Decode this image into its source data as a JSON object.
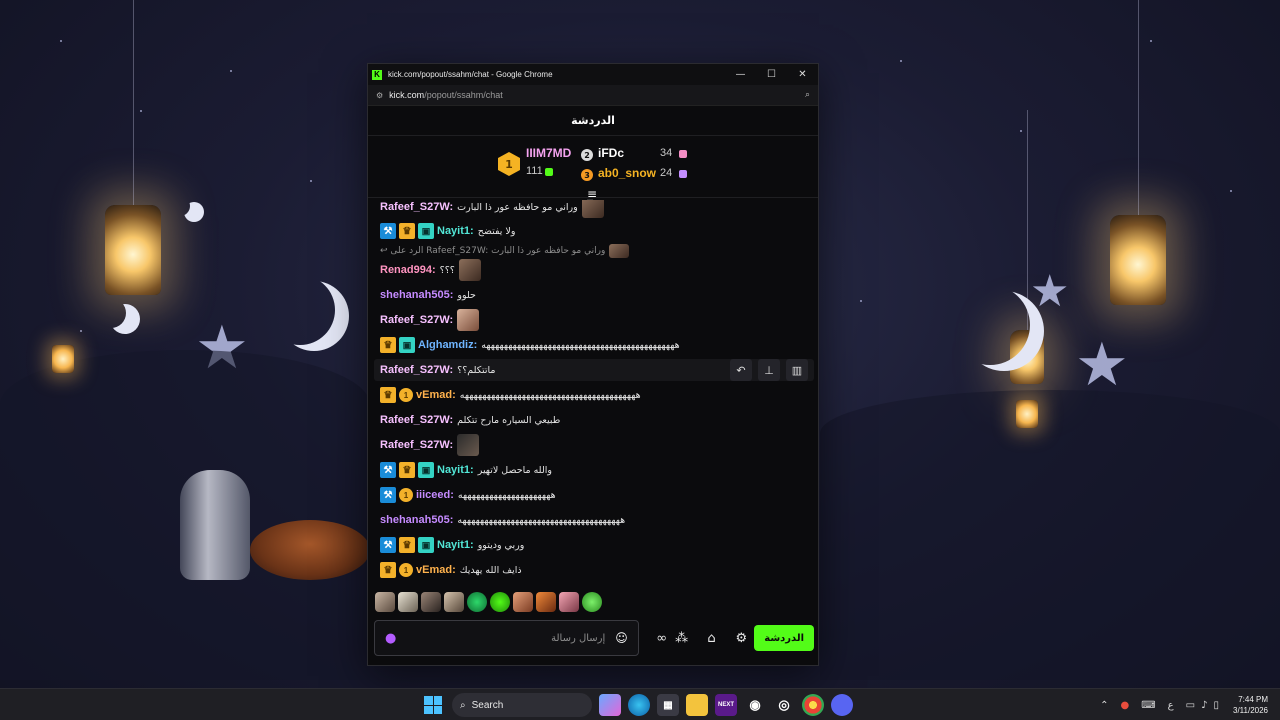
{
  "window": {
    "title": "kick.com/popout/ssahm/chat - Google Chrome",
    "logo_letter": "K",
    "minimize": "—",
    "maximize": "☐",
    "close": "✕"
  },
  "address_bar": {
    "domain": "kick.com",
    "path": "/popout/ssahm/chat"
  },
  "chat": {
    "header_title": "الدردشة",
    "leaderboard": {
      "first": {
        "rank": "1",
        "name": "IIIM7MD",
        "count": "111",
        "color": "#f5a3f0"
      },
      "second": {
        "rank": "2",
        "name": "iFDc",
        "count": "34",
        "color": "#ffffff"
      },
      "third": {
        "rank": "3",
        "name": "ab0_snow",
        "count": "24",
        "color": "#f5b323"
      }
    },
    "messages": [
      {
        "user": "Rafeef_S27W",
        "color": "#f7c1ff",
        "text": "وراني مو حافظه عور ذا البارت"
      },
      {
        "user": "Nayit1",
        "color": "#52e6d6",
        "text": "ولا يفتضح"
      },
      {
        "reply_to": "الرد على Rafeef_S27W: وراني مو حافظه عور ذا البارت"
      },
      {
        "user": "Renad994",
        "color": "#ff94c0",
        "text": "؟؟؟"
      },
      {
        "user": "shehanah505",
        "color": "#c58bff",
        "text": "حلوو"
      },
      {
        "user": "Rafeef_S27W",
        "color": "#f7c1ff",
        "text": ""
      },
      {
        "user": "Alghamdiz",
        "color": "#6fb5ff",
        "text": "ههههههههههههههههههههههههههههههههههههههههههههه"
      },
      {
        "user": "Rafeef_S27W",
        "color": "#f7c1ff",
        "text": "ماتتكلم؟؟"
      },
      {
        "user": "vEmad",
        "color": "#ffb24d",
        "text": "ههههههههههههههههههههههههههههههههههههههههه"
      },
      {
        "user": "Rafeef_S27W",
        "color": "#f7c1ff",
        "text": "طبيعي السياره مارح تتكلم"
      },
      {
        "user": "Rafeef_S27W",
        "color": "#f7c1ff",
        "text": ""
      },
      {
        "user": "Nayit1",
        "color": "#52e6d6",
        "text": "والله ماحصل لاتهير"
      },
      {
        "user": "iiiceed",
        "color": "#c58bff",
        "text": "هههههههههههههههههههههه"
      },
      {
        "user": "shehanah505",
        "color": "#c58bff",
        "text": "هههههههههههههههههههههههههههههههههههههه"
      },
      {
        "user": "Nayit1",
        "color": "#52e6d6",
        "text": "وربي وديتوو"
      },
      {
        "user": "vEmad",
        "color": "#ffb24d",
        "text": "ذايف الله يهديك"
      }
    ],
    "input_placeholder": "إرسال رسالة",
    "send_label": "الدردشة"
  },
  "taskbar": {
    "search_label": "Search",
    "time": "7:44 PM",
    "date": "3/11/2026",
    "lang": "ع"
  },
  "colors": {
    "kick_green": "#53fc18",
    "window_bg": "#0b0b0d"
  }
}
